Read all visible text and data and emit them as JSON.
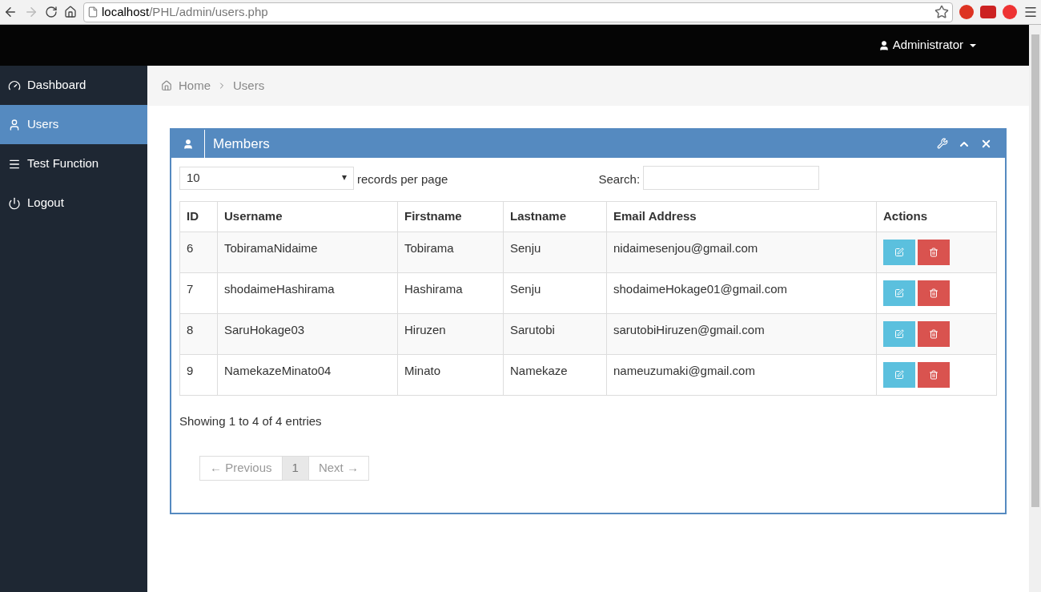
{
  "browser": {
    "url_host": "localhost",
    "url_path": "/PHL/admin/users.php"
  },
  "header": {
    "user_menu": "Administrator"
  },
  "sidebar": {
    "items": [
      {
        "label": "Dashboard",
        "kind": "dashboard",
        "selected": false
      },
      {
        "label": "Users",
        "kind": "user",
        "selected": true
      },
      {
        "label": "Test Function",
        "kind": "list",
        "selected": false
      },
      {
        "label": "Logout",
        "kind": "power",
        "selected": false
      }
    ]
  },
  "breadcrumb": [
    "Home",
    "Users"
  ],
  "panel": {
    "title": "Members",
    "page_size": "10",
    "page_size_label": "records per page",
    "search_label": "Search:",
    "table": {
      "columns": [
        "ID",
        "Username",
        "Firstname",
        "Lastname",
        "Email Address",
        "Actions"
      ],
      "rows": [
        [
          "6",
          "TobiramaNidaime",
          "Tobirama",
          "Senju",
          "nidaimesenjou@gmail.com"
        ],
        [
          "7",
          "shodaimeHashirama",
          "Hashirama",
          "Senju",
          "shodaimeHokage01@gmail.com"
        ],
        [
          "8",
          "SaruHokage03",
          "Hiruzen",
          "Sarutobi",
          "sarutobiHiruzen@gmail.com"
        ],
        [
          "9",
          "NamekazeMinato04",
          "Minato",
          "Namekaze",
          "nameuzumaki@gmail.com"
        ]
      ]
    },
    "info": "Showing 1 to 4 of 4 entries",
    "pagination": [
      {
        "label": "← Previous",
        "selected": false,
        "disabled": true
      },
      {
        "label": "1",
        "selected": true,
        "disabled": false
      },
      {
        "label": "Next →",
        "selected": false,
        "disabled": true
      }
    ]
  }
}
